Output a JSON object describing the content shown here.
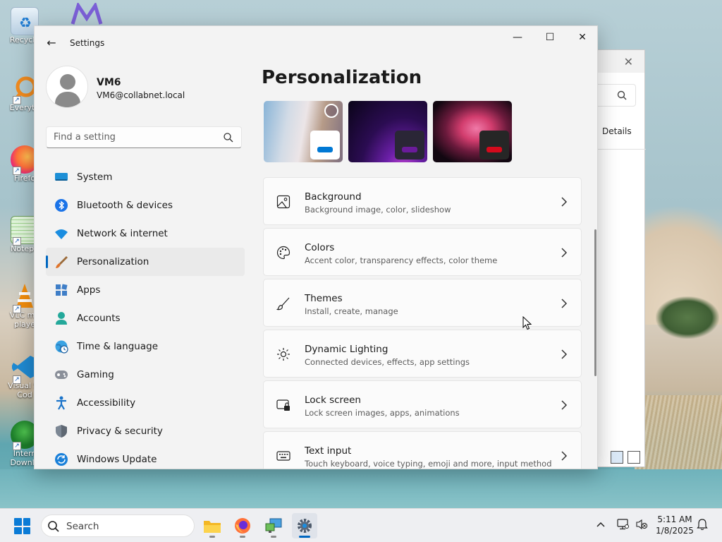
{
  "desktop": {
    "icons": [
      {
        "name": "recycle-bin",
        "label": "Recycle"
      },
      {
        "name": "everything",
        "label": "Everyth"
      },
      {
        "name": "firefox",
        "label": "Firefo"
      },
      {
        "name": "notepad",
        "label": "Notepa"
      },
      {
        "name": "vlc",
        "label": "VLC me",
        "label2": "playe"
      },
      {
        "name": "vscode",
        "label": "Visual St",
        "label2": "Cod"
      },
      {
        "name": "idm",
        "label": "Intern",
        "label2": "Downlo"
      }
    ]
  },
  "back_window": {
    "details_label": "Details"
  },
  "window": {
    "title": "Settings",
    "back_glyph": "←",
    "minimize_glyph": "—",
    "maximize_glyph": "☐",
    "close_glyph": "✕"
  },
  "profile": {
    "name": "VM6",
    "email": "VM6@collabnet.local"
  },
  "search": {
    "placeholder": "Find a setting"
  },
  "nav": [
    {
      "label": "System",
      "icon": "monitor-icon"
    },
    {
      "label": "Bluetooth & devices",
      "icon": "bluetooth-icon"
    },
    {
      "label": "Network & internet",
      "icon": "wifi-icon"
    },
    {
      "label": "Personalization",
      "icon": "brush-icon",
      "active": true
    },
    {
      "label": "Apps",
      "icon": "apps-icon"
    },
    {
      "label": "Accounts",
      "icon": "person-icon"
    },
    {
      "label": "Time & language",
      "icon": "globe-clock-icon"
    },
    {
      "label": "Gaming",
      "icon": "gamepad-icon"
    },
    {
      "label": "Accessibility",
      "icon": "accessibility-icon"
    },
    {
      "label": "Privacy & security",
      "icon": "shield-icon"
    },
    {
      "label": "Windows Update",
      "icon": "update-icon"
    }
  ],
  "page": {
    "title": "Personalization"
  },
  "themes": [
    {
      "name": "windows-light",
      "accent": "#0078d4",
      "selected": true
    },
    {
      "name": "windows-dark-glow",
      "accent": "#6a1b9a"
    },
    {
      "name": "flower-dark",
      "accent": "#d40a1c"
    }
  ],
  "cards": [
    {
      "title": "Background",
      "subtitle": "Background image, color, slideshow",
      "icon": "image-icon"
    },
    {
      "title": "Colors",
      "subtitle": "Accent color, transparency effects, color theme",
      "icon": "palette-icon"
    },
    {
      "title": "Themes",
      "subtitle": "Install, create, manage",
      "icon": "brush-icon"
    },
    {
      "title": "Dynamic Lighting",
      "subtitle": "Connected devices, effects, app settings",
      "icon": "lighting-icon"
    },
    {
      "title": "Lock screen",
      "subtitle": "Lock screen images, apps, animations",
      "icon": "lock-screen-icon"
    },
    {
      "title": "Text input",
      "subtitle": "Touch keyboard, voice typing, emoji and more, input method",
      "icon": "keyboard-icon"
    }
  ],
  "taskbar": {
    "search_label": "Search",
    "time": "5:11 AM",
    "date": "1/8/2025"
  },
  "colors": {
    "accent": "#0067c0",
    "window_bg": "#f3f3f3",
    "card_bg": "#fbfbfb"
  }
}
